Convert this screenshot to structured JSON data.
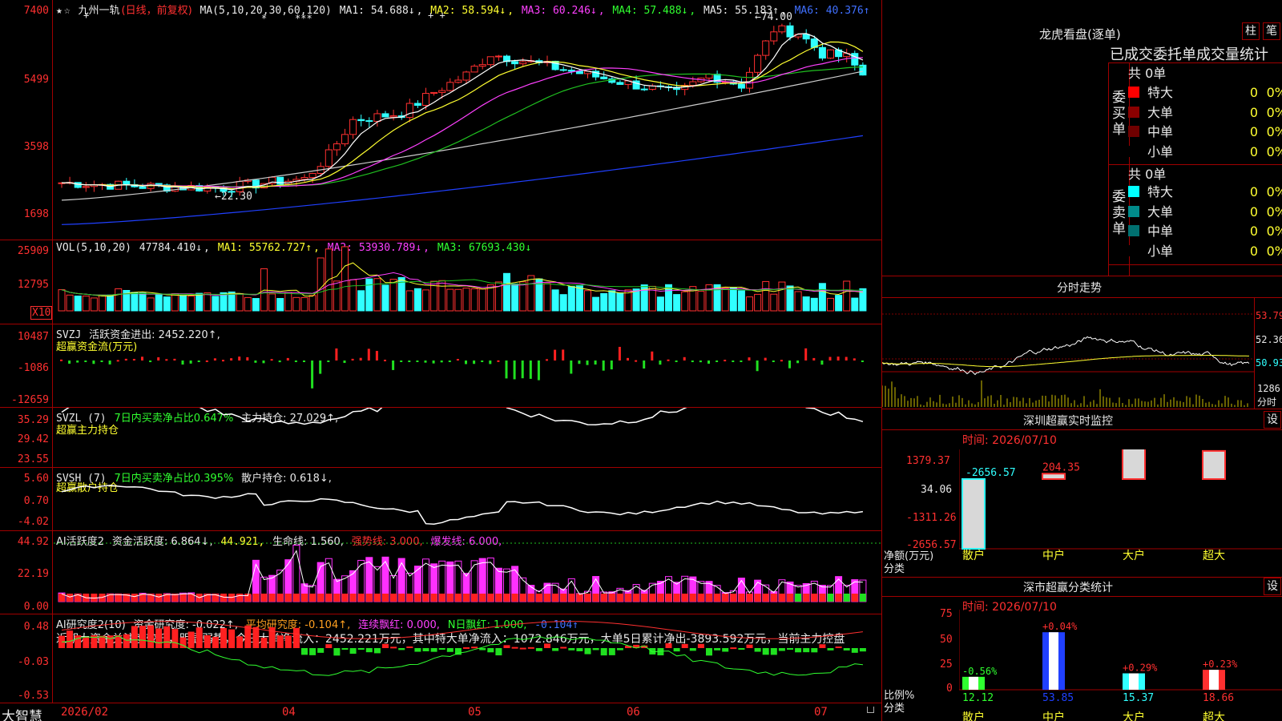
{
  "app": {
    "logo_text": "大智慧",
    "lock_icon": "lock-icon"
  },
  "main": {
    "stock_name": "九州一轨",
    "period": "(日线，前复权)",
    "ma_header": "MA(5,10,20,30,60,120)",
    "ma_values": [
      "MA1: 54.688↓",
      "MA2: 58.594↓",
      "MA3: 60.246↓",
      "MA4: 57.488↓",
      "MA5: 55.183↑",
      "MA6: 40.376↑"
    ],
    "yaxis": [
      "7400",
      "5499",
      "3598",
      "1698"
    ],
    "high_label": "←74.00",
    "low_label": "←22.30",
    "markers": {
      "m1": "*",
      "m2": "***",
      "m3": "+",
      "m4": "+ +"
    }
  },
  "vol": {
    "header": "VOL(5,10,20)",
    "value": "47784.410↓",
    "ma": [
      "MA1: 55762.727↑",
      "MA2: 53930.789↓",
      "MA3: 67693.430↓"
    ],
    "yaxis": [
      "25909",
      "12795"
    ],
    "unit": "X10"
  },
  "svzj": {
    "header": "SVZJ",
    "line1": "活跃资金进出: 2452.220↑,",
    "line2": "超赢资金流(万元)",
    "yaxis": [
      "10487",
      "-1086",
      "-12659"
    ]
  },
  "svzl": {
    "header": "SVZL (7)",
    "h2": "7日内买卖净占比0.647%",
    "h3": "主力持仓: 27.029↑,",
    "line2": "超赢主力持仓",
    "yaxis": [
      "35.29",
      "29.42",
      "23.55"
    ]
  },
  "svsh": {
    "header": "SVSH (7)",
    "h2": "7日内买卖净占比0.395%",
    "h3": "散户持仓: 0.618↓,",
    "line2": "超赢散户持仓",
    "yaxis": [
      "5.60",
      "0.70",
      "-4.02"
    ]
  },
  "ai1": {
    "header": "AI活跃度2",
    "h2": "资金活跃度: 6.864↓,",
    "h3": "44.921,",
    "h4": "生命线: 1.560,",
    "h5": "强势线: 3.000,",
    "h6": "爆发线: 6.000,",
    "yaxis": [
      "44.92",
      "22.19",
      "0.00"
    ]
  },
  "ai2": {
    "header": "AI研究度2(10)",
    "h2": "资金研究度: -0.022↑,",
    "h3": "平均研究度: -0.104↑,",
    "h4": "连续飘红: 0.000,",
    "h5": "N日飘红: 1.000,",
    "h6": "-0.104↑",
    "comment": "近期大资金关注度较低，明显弱势，今日大单净流入：2452.221万元，其中特大单净流入：1072.846万元，大单5日累计净出-3893.592万元，当前主力控盘",
    "yaxis": [
      "0.48",
      "-0.03",
      "-0.53"
    ]
  },
  "xaxis": [
    "2026/02",
    "04",
    "05",
    "06",
    "07"
  ],
  "lhb": {
    "title": "龙虎看盘(逐单)",
    "btn1": "柱",
    "btn2": "笔",
    "tabs": "已成交委托单成交量统计",
    "buy": {
      "side": "委买单",
      "total": "共 0单",
      "rows": [
        {
          "label": "特大",
          "v": "0",
          "p": "0%",
          "color": "#ff0000"
        },
        {
          "label": "大单",
          "v": "0",
          "p": "0%",
          "color": "#8b0000"
        },
        {
          "label": "中单",
          "v": "0",
          "p": "0%",
          "color": "#700000"
        },
        {
          "label": "小单",
          "v": "0",
          "p": "0%",
          "color": "#000000"
        }
      ]
    },
    "sell": {
      "side": "委卖单",
      "total": "共 0单",
      "rows": [
        {
          "label": "特大",
          "v": "0",
          "p": "0%",
          "color": "#00ffff"
        },
        {
          "label": "大单",
          "v": "0",
          "p": "0%",
          "color": "#008b8b"
        },
        {
          "label": "中单",
          "v": "0",
          "p": "0%",
          "color": "#007070"
        },
        {
          "label": "小单",
          "v": "0",
          "p": "0%",
          "color": "#000000"
        }
      ]
    }
  },
  "intraday": {
    "title": "分时走势",
    "yaxis": [
      "53.79",
      "52.36",
      "50.93"
    ],
    "vol": "1286",
    "unit": "分时"
  },
  "monitor": {
    "title": "深圳超赢实时监控",
    "btn": "设",
    "time": "时间: 2026/07/10",
    "yaxis": [
      "1379.37",
      "34.06",
      "-1311.26",
      "-2656.57"
    ],
    "ylabel": "净额(万元)",
    "xlabel": "分类",
    "categories": [
      "散户",
      "中户",
      "大户",
      "超大"
    ],
    "values": [
      -2656.57,
      204.35,
      1379.37,
      1072.85
    ],
    "labels": [
      "-2656.57",
      "204.35",
      "1379.37",
      "1072.85"
    ]
  },
  "classify": {
    "title": "深市超赢分类统计",
    "btn": "设",
    "time": "时间: 2026/07/10",
    "yaxis": [
      "75",
      "50",
      "25",
      "0"
    ],
    "ylabel": "比例%",
    "xlabel": "分类",
    "categories": [
      "散户",
      "中户",
      "大户",
      "超大"
    ],
    "values": [
      12.12,
      53.85,
      15.37,
      18.66
    ],
    "labels": [
      "12.12",
      "53.85",
      "15.37",
      "18.66"
    ],
    "changes": [
      "-0.56%",
      "+0.04%",
      "+0.29%",
      "+0.23%"
    ]
  }
}
